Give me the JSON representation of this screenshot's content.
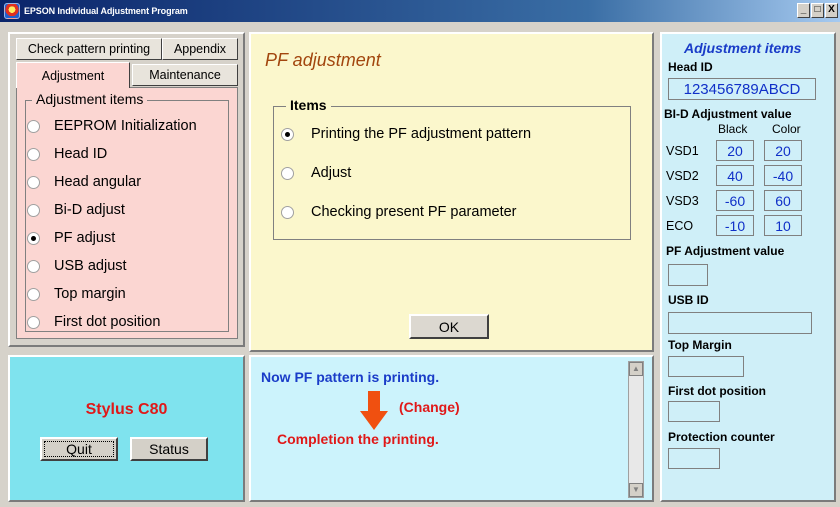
{
  "window": {
    "title": "EPSON Individual Adjustment Program",
    "buttons": [
      "_",
      "□",
      "X"
    ]
  },
  "tabs": {
    "row1": [
      "Check pattern printing",
      "Appendix"
    ],
    "row2": [
      "Adjustment",
      "Maintenance"
    ]
  },
  "adjustment_items": {
    "legend": "Adjustment items",
    "items": [
      {
        "label": "EEPROM Initialization",
        "checked": false
      },
      {
        "label": "Head ID",
        "checked": false
      },
      {
        "label": "Head angular",
        "checked": false
      },
      {
        "label": "Bi-D adjust",
        "checked": false
      },
      {
        "label": "PF adjust",
        "checked": true
      },
      {
        "label": "USB adjust",
        "checked": false
      },
      {
        "label": "Top margin",
        "checked": false
      },
      {
        "label": "First dot position",
        "checked": false
      }
    ]
  },
  "center": {
    "title": "PF adjustment",
    "legend": "Items",
    "options": [
      {
        "label": "Printing the PF adjustment pattern",
        "checked": true
      },
      {
        "label": "Adjust",
        "checked": false
      },
      {
        "label": "Checking present PF parameter",
        "checked": false
      }
    ],
    "ok_label": "OK"
  },
  "model": {
    "name": "Stylus C80",
    "quit_label": "Quit",
    "status_label": "Status"
  },
  "message": {
    "line1": "Now PF pattern is printing.",
    "change": "(Change)",
    "line2": "Completion the printing."
  },
  "right": {
    "title": "Adjustment items",
    "head_id_label": "Head ID",
    "head_id_value": "123456789ABCD",
    "bid_label": "BI-D Adjustment value",
    "col_black": "Black",
    "col_color": "Color",
    "rows": [
      {
        "name": "VSD1",
        "black": "20",
        "color": "20"
      },
      {
        "name": "VSD2",
        "black": "40",
        "color": "-40"
      },
      {
        "name": "VSD3",
        "black": "-60",
        "color": "60"
      },
      {
        "name": "ECO",
        "black": "-10",
        "color": "10"
      }
    ],
    "pf_label": "PF Adjustment value",
    "usb_label": "USB ID",
    "top_margin_label": "Top Margin",
    "first_dot_label": "First dot position",
    "protection_label": "Protection counter"
  },
  "colors": {
    "title_blue": "#0a246a",
    "left_pink": "#fbd6d2",
    "center_yellow": "#fbf7cc",
    "model_cyan": "#7fe3ee",
    "msg_blue_text": "#1a3cc8",
    "red_text": "#e01818"
  }
}
